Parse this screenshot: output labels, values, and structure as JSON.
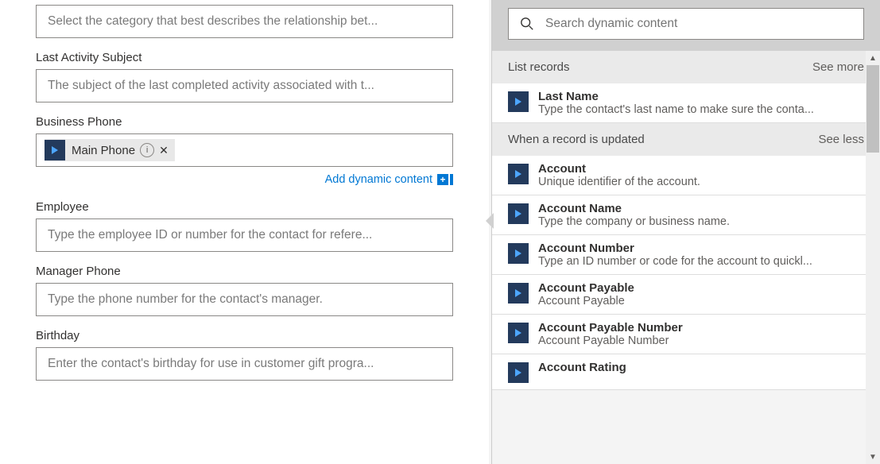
{
  "fields": {
    "category": {
      "placeholder": "Select the category that best describes the relationship bet..."
    },
    "lastActivitySubject": {
      "label": "Last Activity Subject",
      "placeholder": "The subject of the last completed activity associated with t..."
    },
    "businessPhone": {
      "label": "Business Phone",
      "token": "Main Phone"
    },
    "employee": {
      "label": "Employee",
      "placeholder": "Type the employee ID or number for the contact for refere..."
    },
    "managerPhone": {
      "label": "Manager Phone",
      "placeholder": "Type the phone number for the contact's manager."
    },
    "birthday": {
      "label": "Birthday",
      "placeholder": "Enter the contact's birthday for use in customer gift progra..."
    }
  },
  "addDynamicLabel": "Add dynamic content",
  "search": {
    "placeholder": "Search dynamic content"
  },
  "groups": {
    "listRecords": {
      "title": "List records",
      "link": "See more",
      "items": [
        {
          "title": "Last Name",
          "desc": "Type the contact's last name to make sure the conta..."
        }
      ]
    },
    "whenUpdated": {
      "title": "When a record is updated",
      "link": "See less",
      "items": [
        {
          "title": "Account",
          "desc": "Unique identifier of the account."
        },
        {
          "title": "Account Name",
          "desc": "Type the company or business name."
        },
        {
          "title": "Account Number",
          "desc": "Type an ID number or code for the account to quickl..."
        },
        {
          "title": "Account Payable",
          "desc": "Account Payable"
        },
        {
          "title": "Account Payable Number",
          "desc": "Account Payable Number"
        },
        {
          "title": "Account Rating",
          "desc": ""
        }
      ]
    }
  }
}
